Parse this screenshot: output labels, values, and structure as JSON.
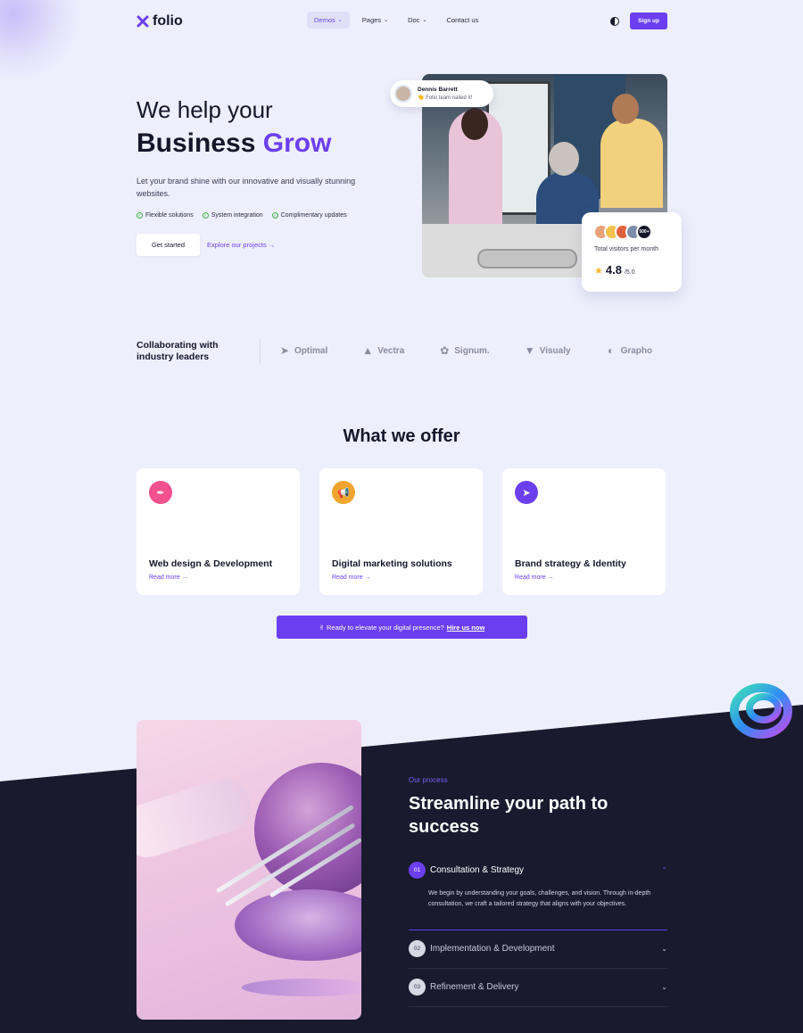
{
  "brand": {
    "name": "folio",
    "color": "#6b3ff0"
  },
  "nav": {
    "items": [
      {
        "label": "Demos",
        "active": true,
        "has_caret": true
      },
      {
        "label": "Pages",
        "active": false,
        "has_caret": true
      },
      {
        "label": "Doc",
        "active": false,
        "has_caret": true
      },
      {
        "label": "Contact us",
        "active": false,
        "has_caret": false
      }
    ],
    "theme_icon": "contrast-icon",
    "signup_label": "Sign up"
  },
  "hero": {
    "title_line1": "We help your",
    "title_line2_plain": "Business",
    "title_line2_accent": "Grow",
    "subtitle": "Let your brand shine with our innovative and visually stunning websites.",
    "checks": [
      "Flexible solutions",
      "System integration",
      "Complimentary updates"
    ],
    "primary_button": "Get started",
    "secondary_link": "Explore our projects →"
  },
  "testimonial_badge": {
    "name": "Dennis Barrett",
    "message": "👏 Folio team nailed it!"
  },
  "visitors_card": {
    "count_badge": "500+",
    "label": "Total visitors per month",
    "rating": "4.8",
    "rating_max": "/5.0"
  },
  "partners": {
    "heading": "Collaborating with industry leaders",
    "logos": [
      {
        "name": "Optimal",
        "icon": "paper-plane-icon"
      },
      {
        "name": "Vectra",
        "icon": "cubes-icon"
      },
      {
        "name": "Signum.",
        "icon": "aperture-icon"
      },
      {
        "name": "Visualy",
        "icon": "v-shield-icon"
      },
      {
        "name": "Grapho",
        "icon": "rings-icon"
      }
    ]
  },
  "offer": {
    "title": "What we offer",
    "cards": [
      {
        "title": "Web design & Development",
        "link": "Read more →",
        "icon": "pen-tool-icon",
        "color": "#f2508f"
      },
      {
        "title": "Digital marketing solutions",
        "link": "Read more →",
        "icon": "megaphone-icon",
        "color": "#f1a52e"
      },
      {
        "title": "Brand strategy & Identity",
        "link": "Read more →",
        "icon": "rocket-icon",
        "color": "#6b3ff0"
      }
    ],
    "cta_text": "✌ Ready to elevate your digital presence?",
    "cta_link": "Hire us now"
  },
  "process": {
    "kicker": "Our process",
    "title": "Streamline your path to success",
    "steps": [
      {
        "num": "01",
        "title": "Consultation & Strategy",
        "expanded": true,
        "body": "We begin by understanding your goals, challenges, and vision. Through in-depth consultation, we craft a tailored strategy that aligns with your objectives."
      },
      {
        "num": "02",
        "title": "Implementation & Development",
        "expanded": false
      },
      {
        "num": "03",
        "title": "Refinement & Delivery",
        "expanded": false
      }
    ]
  }
}
